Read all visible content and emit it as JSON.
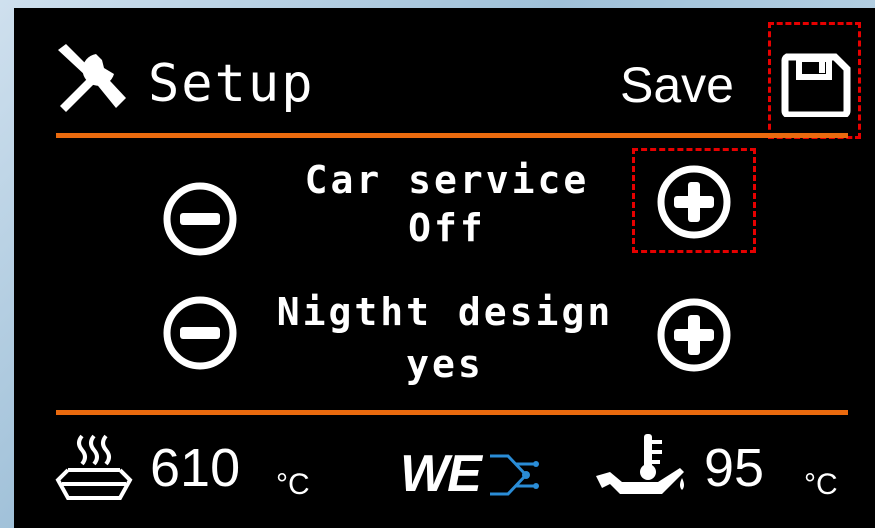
{
  "header": {
    "title": "Setup",
    "save_label": "Save"
  },
  "settings": [
    {
      "label": "Car service",
      "value": "Off"
    },
    {
      "label": "Nigtht design",
      "value": "yes"
    }
  ],
  "footer": {
    "exhaust_temp": "610",
    "exhaust_unit": "°C",
    "oil_temp": "95",
    "oil_unit": "°C",
    "logo_text": "WE"
  },
  "colors": {
    "accent": "#ea6a0e",
    "highlight": "#e60000",
    "background": "#000000",
    "foreground": "#ffffff"
  },
  "icons": [
    "tools-icon",
    "save-icon",
    "minus-circle-icon",
    "plus-circle-icon",
    "exhaust-heat-icon",
    "oil-temperature-icon"
  ]
}
